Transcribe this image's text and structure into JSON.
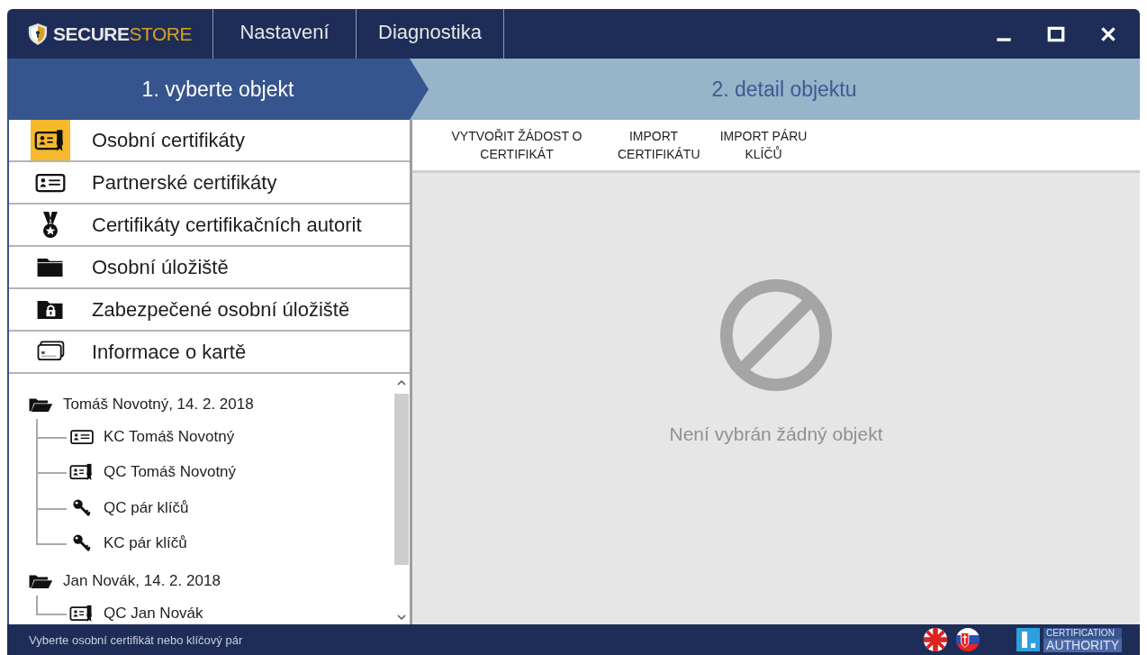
{
  "app": {
    "brand": {
      "primary": "SECURE",
      "accent": "STORE"
    },
    "menu": [
      {
        "label": "Nastavení"
      },
      {
        "label": "Diagnostika"
      }
    ]
  },
  "steps": [
    {
      "label": "1. vyberte objekt",
      "selected": true
    },
    {
      "label": "2. detail objektu",
      "selected": false
    }
  ],
  "categories": [
    {
      "label": "Osobní certifikáty",
      "kind": "cert",
      "selected": true
    },
    {
      "label": "Partnerské certifikáty",
      "kind": "card",
      "selected": false
    },
    {
      "label": "Certifikáty certifikačních autorit",
      "kind": "medal",
      "selected": false
    },
    {
      "label": "Osobní úložiště",
      "kind": "folder",
      "selected": false
    },
    {
      "label": "Zabezpečené osobní úložiště",
      "kind": "lockfolder",
      "selected": false
    },
    {
      "label": "Informace o kartě",
      "kind": "cards",
      "selected": false
    }
  ],
  "tree": [
    {
      "label": "Tomáš Novotný, 14. 2. 2018",
      "kind": "folder",
      "children": [
        {
          "label": "KC Tomáš Novotný",
          "kind": "card"
        },
        {
          "label": "QC Tomáš Novotný",
          "kind": "cert"
        },
        {
          "label": "QC pár klíčů",
          "kind": "key"
        },
        {
          "label": "KC pár klíčů",
          "kind": "key"
        }
      ]
    },
    {
      "label": "Jan Novák, 14. 2. 2018",
      "kind": "folder",
      "children": [
        {
          "label": "QC Jan Novák",
          "kind": "cert"
        }
      ]
    }
  ],
  "toolbar": [
    {
      "label": "VYTVOŘIT ŽÁDOST O CERTIFIKÁT"
    },
    {
      "label": "IMPORT CERTIFIKÁTU"
    },
    {
      "label": "IMPORT PÁRU KLÍČŮ"
    }
  ],
  "empty_state": {
    "message": "Není vybrán žádný objekt"
  },
  "status_bar": {
    "message": "Vyberte osobní certifikát nebo klíčový pár",
    "ca_logo": {
      "line1": "CERTIFICATION",
      "line2": "AUTHORITY"
    }
  }
}
